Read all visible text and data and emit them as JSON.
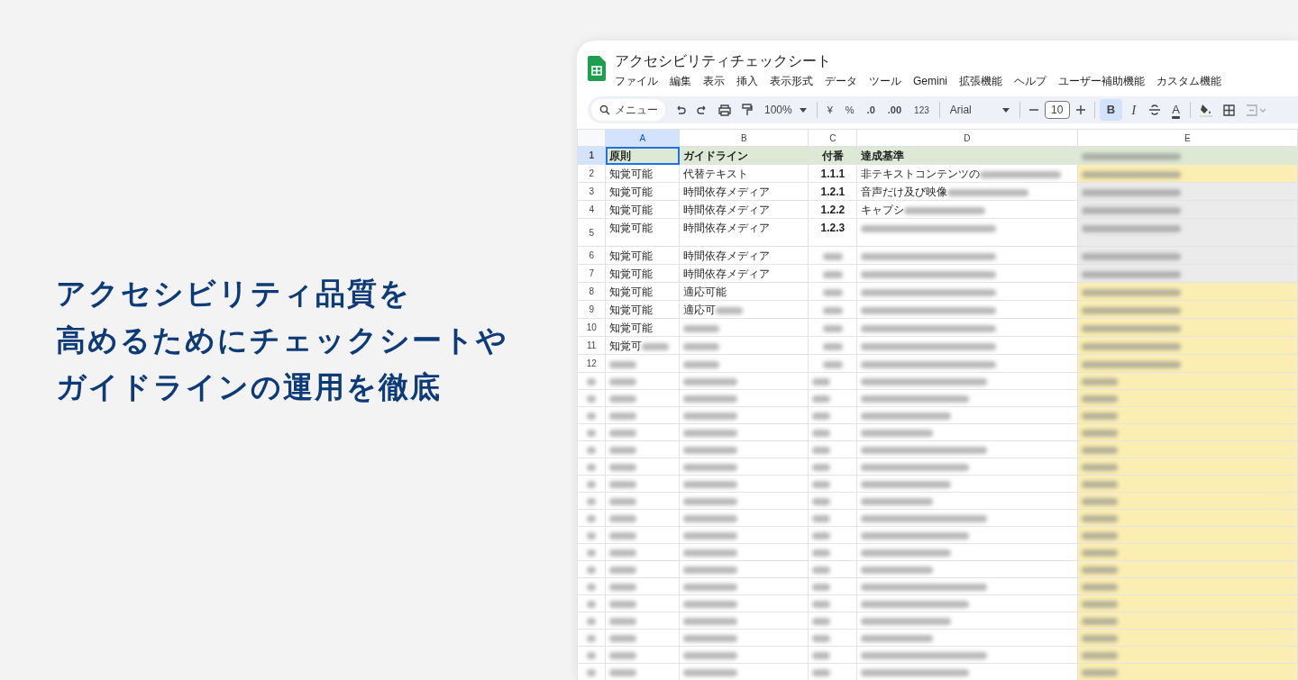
{
  "headline": [
    "アクセシビリティ品質を",
    "高めるためにチェックシートや",
    "ガイドラインの運用を徹底"
  ],
  "spreadsheet": {
    "title": "アクセシビリティチェックシート",
    "menu": [
      "ファイル",
      "編集",
      "表示",
      "挿入",
      "表示形式",
      "データ",
      "ツール",
      "Gemini",
      "拡張機能",
      "ヘルプ",
      "ユーザー補助機能",
      "カスタム機能"
    ],
    "toolbar": {
      "search_placeholder": "メニュー",
      "zoom": "100%",
      "currency": "¥",
      "percent": "%",
      "decrease_decimal": ".0",
      "increase_decimal": ".00",
      "number_format": "123",
      "font": "Arial",
      "font_size": "10",
      "bold": {
        "label": "B",
        "selected": true
      },
      "italic": {
        "label": "I",
        "selected": false
      },
      "text_color": "A"
    },
    "columns": [
      {
        "label": "A",
        "selected": true
      },
      {
        "label": "B",
        "selected": false
      },
      {
        "label": "C",
        "selected": false
      },
      {
        "label": "D",
        "selected": false
      },
      {
        "label": "E",
        "selected": false
      }
    ],
    "header_row": {
      "number": "1",
      "cells": [
        {
          "text": "原則"
        },
        {
          "text": "ガイドライン"
        },
        {
          "text": "付番"
        },
        {
          "text": "達成基準"
        },
        {
          "blurred": true
        }
      ]
    },
    "rows": [
      {
        "number": "2",
        "tall": false,
        "color": "#fbeeb2",
        "cells": [
          {
            "text": "知覚可能"
          },
          {
            "text": "代替テキスト"
          },
          {
            "text": "1.1.1"
          },
          {
            "text": "非テキストコンテンツの",
            "blurred": true
          },
          {
            "blurred": true
          }
        ]
      },
      {
        "number": "3",
        "tall": false,
        "color": "#ebebeb",
        "cells": [
          {
            "text": "知覚可能"
          },
          {
            "text": "時間依存メディア"
          },
          {
            "text": "1.2.1"
          },
          {
            "text": "音声だけ及び映像",
            "blurred": true
          },
          {
            "blurred": true
          }
        ]
      },
      {
        "number": "4",
        "tall": false,
        "color": "#ebebeb",
        "cells": [
          {
            "text": "知覚可能"
          },
          {
            "text": "時間依存メディア"
          },
          {
            "text": "1.2.2"
          },
          {
            "text": "キャプシ",
            "blurred": true
          },
          {
            "blurred": true
          }
        ]
      },
      {
        "number": "5",
        "tall": true,
        "color": "#ebebeb",
        "cells": [
          {
            "text": "知覚可能"
          },
          {
            "text": "時間依存メディア"
          },
          {
            "text": "1.2.3"
          },
          {
            "blurred": true
          },
          {
            "blurred": true
          }
        ]
      },
      {
        "number": "6",
        "tall": false,
        "color": "#ebebeb",
        "cells": [
          {
            "text": "知覚可能"
          },
          {
            "text": "時間依存メディア"
          },
          {
            "blurred": true
          },
          {
            "blurred": true
          },
          {
            "blurred": true
          }
        ]
      },
      {
        "number": "7",
        "tall": false,
        "color": "#ebebeb",
        "cells": [
          {
            "text": "知覚可能"
          },
          {
            "text": "時間依存メディア"
          },
          {
            "blurred": true
          },
          {
            "blurred": true
          },
          {
            "blurred": true
          }
        ]
      },
      {
        "number": "8",
        "tall": false,
        "color": "#fbeeb2",
        "cells": [
          {
            "text": "知覚可能"
          },
          {
            "text": "適応可能"
          },
          {
            "blurred": true
          },
          {
            "blurred": true
          },
          {
            "blurred": true
          }
        ]
      },
      {
        "number": "9",
        "tall": false,
        "color": "#fbeeb2",
        "cells": [
          {
            "text": "知覚可能"
          },
          {
            "text": "適応可",
            "blurred": true
          },
          {
            "blurred": true
          },
          {
            "blurred": true
          },
          {
            "blurred": true
          }
        ]
      },
      {
        "number": "10",
        "tall": false,
        "color": "#fbeeb2",
        "cells": [
          {
            "text": "知覚可能"
          },
          {
            "blurred": true
          },
          {
            "blurred": true
          },
          {
            "blurred": true
          },
          {
            "blurred": true
          }
        ]
      },
      {
        "number": "11",
        "tall": false,
        "color": "#fbeeb2",
        "cells": [
          {
            "text": "知覚可",
            "blurred": true
          },
          {
            "blurred": true
          },
          {
            "blurred": true
          },
          {
            "blurred": true
          },
          {
            "blurred": true
          }
        ]
      },
      {
        "number": "12",
        "tall": false,
        "color": "#fbeeb2",
        "cells": [
          {
            "blurred": true
          },
          {
            "blurred": true
          },
          {
            "blurred": true
          },
          {
            "blurred": true
          },
          {
            "blurred": true
          }
        ]
      }
    ]
  }
}
